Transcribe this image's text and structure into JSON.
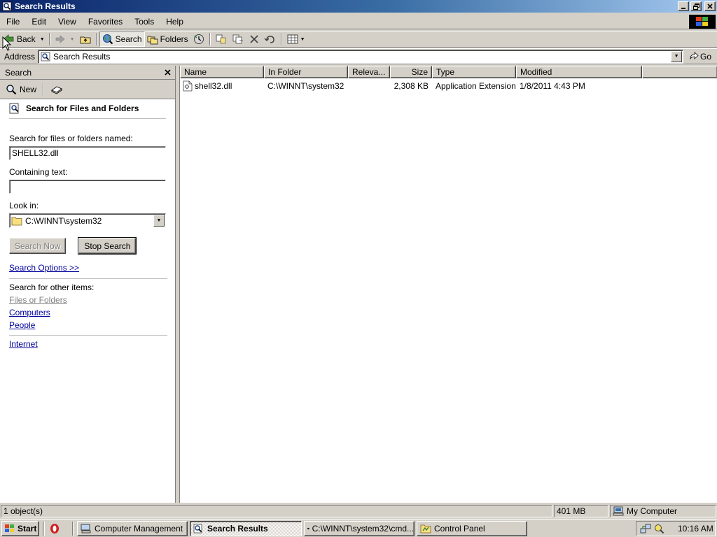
{
  "window": {
    "title": "Search Results",
    "icon": "search-results-icon"
  },
  "menubar": [
    "File",
    "Edit",
    "View",
    "Favorites",
    "Tools",
    "Help"
  ],
  "toolbar": {
    "back_label": "Back",
    "search_label": "Search",
    "folders_label": "Folders"
  },
  "address": {
    "label": "Address",
    "value": "Search Results",
    "go_label": "Go"
  },
  "search_pane": {
    "title": "Search",
    "new_label": "New",
    "heading": "Search for Files and Folders",
    "named_label": "Search for files or folders named:",
    "named_value": "SHELL32.dll",
    "containing_label": "Containing text:",
    "containing_value": "",
    "lookin_label": "Look in:",
    "lookin_value": "C:\\WINNT\\system32",
    "search_now_label": "Search Now",
    "stop_search_label": "Stop Search",
    "options_label": "Search Options >>",
    "other_items_label": "Search for other items:",
    "other_items": [
      "Files or Folders",
      "Computers",
      "People"
    ],
    "internet_label": "Internet"
  },
  "results": {
    "columns": [
      "Name",
      "In Folder",
      "Releva...",
      "Size",
      "Type",
      "Modified"
    ],
    "rows": [
      {
        "name": "shell32.dll",
        "folder": "C:\\WINNT\\system32",
        "relevance": "",
        "size": "2,308 KB",
        "type": "Application Extension",
        "modified": "1/8/2011 4:43 PM"
      }
    ]
  },
  "statusbar": {
    "objects": "1 object(s)",
    "size": "401 MB",
    "zone": "My Computer"
  },
  "taskbar": {
    "start_label": "Start",
    "tasks": [
      {
        "label": "Computer Management",
        "active": false
      },
      {
        "label": "Search Results",
        "active": true
      },
      {
        "label": "C:\\WINNT\\system32\\cmd...",
        "active": false
      },
      {
        "label": "Control Panel",
        "active": false
      }
    ],
    "clock": "10:16 AM"
  },
  "colors": {
    "titlebar_start": "#0a246a",
    "titlebar_end": "#a6caf0",
    "face": "#d4d0c8",
    "link": "#00009c"
  }
}
